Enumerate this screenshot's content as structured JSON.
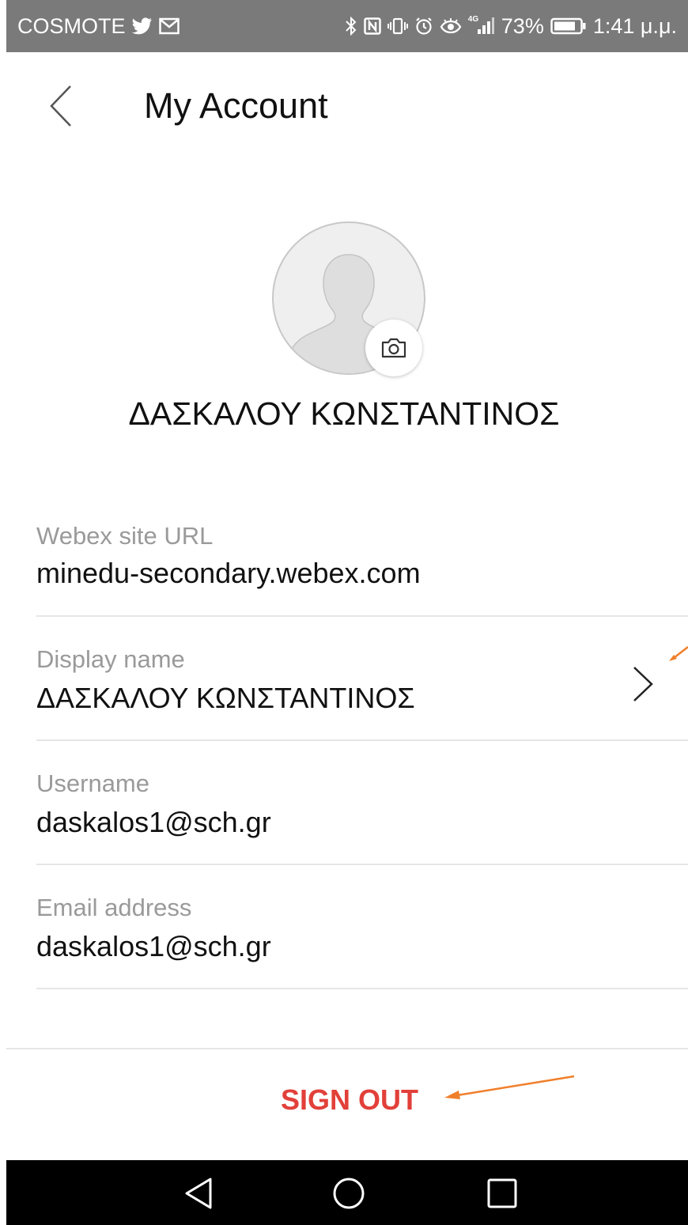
{
  "status_bar": {
    "carrier": "COSMOTE",
    "network": "4G",
    "battery": "73%",
    "time": "1:41 μ.μ.",
    "icons_left": [
      "twitter-icon",
      "mail-icon"
    ],
    "icons_right": [
      "bluetooth-icon",
      "nfc-icon",
      "vibrate-icon",
      "alarm-icon",
      "eye-icon",
      "signal-icon",
      "battery-icon"
    ]
  },
  "header": {
    "title": "My Account",
    "back_icon": "chevron-left-icon"
  },
  "profile": {
    "name": "ΔΑΣΚΑΛΟΥ ΚΩΝΣΤΑΝΤΙΝΟΣ",
    "avatar_icon": "person-silhouette-icon",
    "camera_icon": "camera-icon"
  },
  "fields": [
    {
      "label": "Webex site URL",
      "value": "minedu-secondary.webex.com"
    },
    {
      "label": "Display name",
      "value": "ΔΑΣΚΑΛΟΥ ΚΩΝΣΤΑΝΤΙΝΟΣ",
      "chevron_icon": "chevron-right-icon"
    },
    {
      "label": "Username",
      "value": "daskalos1@sch.gr"
    },
    {
      "label": "Email address",
      "value": "daskalos1@sch.gr"
    }
  ],
  "sign_out": {
    "label": "SIGN OUT"
  },
  "annotations": {
    "arrow_color": "#f07f2a"
  },
  "colors": {
    "accent_red": "#e2403a",
    "status_bar_bg": "#7a7a7a"
  },
  "nav_bar": {
    "icons": [
      "back-triangle-icon",
      "home-circle-icon",
      "recents-square-icon"
    ]
  }
}
